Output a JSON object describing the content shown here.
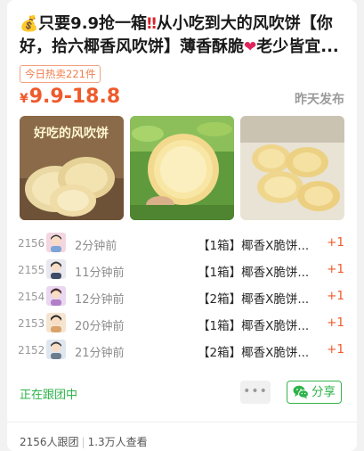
{
  "post": {
    "title_part1": "只要9.9抢一箱",
    "title_part2": "从小吃到大的风吹饼【你好，拾六椰香风吹饼】薄香酥脆",
    "title_part3": "老少皆宜...",
    "icons": [
      "money-bag-icon",
      "double-exclamation-icon",
      "heart-icon"
    ],
    "hot_badge": "今日热卖221件",
    "price_symbol": "¥",
    "price_range": "9.9-18.8",
    "posted_label": "昨天发布"
  },
  "images": [
    {
      "name": "product-image-1",
      "caption": "好吃的风吹饼"
    },
    {
      "name": "product-image-2",
      "caption": ""
    },
    {
      "name": "product-image-3",
      "caption": ""
    }
  ],
  "orders": [
    {
      "num": "2156",
      "time": "2分钟前",
      "item": "【1箱】椰香X脆饼...",
      "qty": "+1"
    },
    {
      "num": "2155",
      "time": "11分钟前",
      "item": "【1箱】椰香X脆饼...",
      "qty": "+1"
    },
    {
      "num": "2154",
      "time": "12分钟前",
      "item": "【2箱】椰香X脆饼...",
      "qty": "+1"
    },
    {
      "num": "2153",
      "time": "20分钟前",
      "item": "【1箱】椰香X脆饼...",
      "qty": "+1"
    },
    {
      "num": "2152",
      "time": "21分钟前",
      "item": "【2箱】椰香X脆饼...",
      "qty": "+1"
    }
  ],
  "status_text": "正在跟团中",
  "more_label": "•••",
  "share_label": "分享",
  "footer": {
    "followers": "2156人跟团",
    "views": "1.3万人查看"
  },
  "colors": {
    "accent": "#f05a2a",
    "green": "#2cb34a",
    "muted": "#9a9a9a"
  }
}
